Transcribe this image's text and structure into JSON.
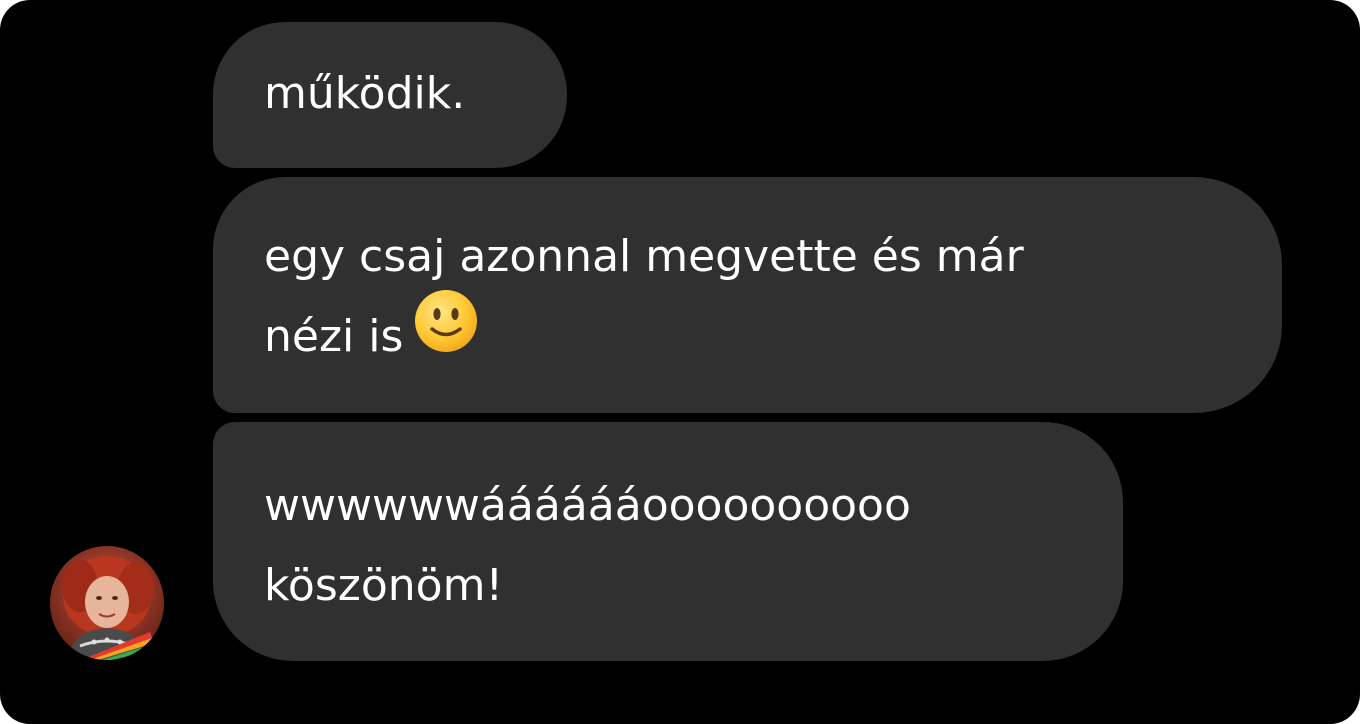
{
  "conversation": {
    "messages": [
      {
        "lines": [
          "működik."
        ]
      },
      {
        "lines": [
          "egy csaj azonnal megvette és már",
          "nézi is"
        ],
        "emoji": "slightly-smiling-face"
      },
      {
        "lines": [
          "wwwwwwááááááoooooooooo",
          "köszönöm!"
        ]
      }
    ],
    "sender": {
      "avatar": "profile-photo"
    }
  },
  "colors": {
    "background": "#000000",
    "bubble": "#303030",
    "text": "#ffffff"
  }
}
